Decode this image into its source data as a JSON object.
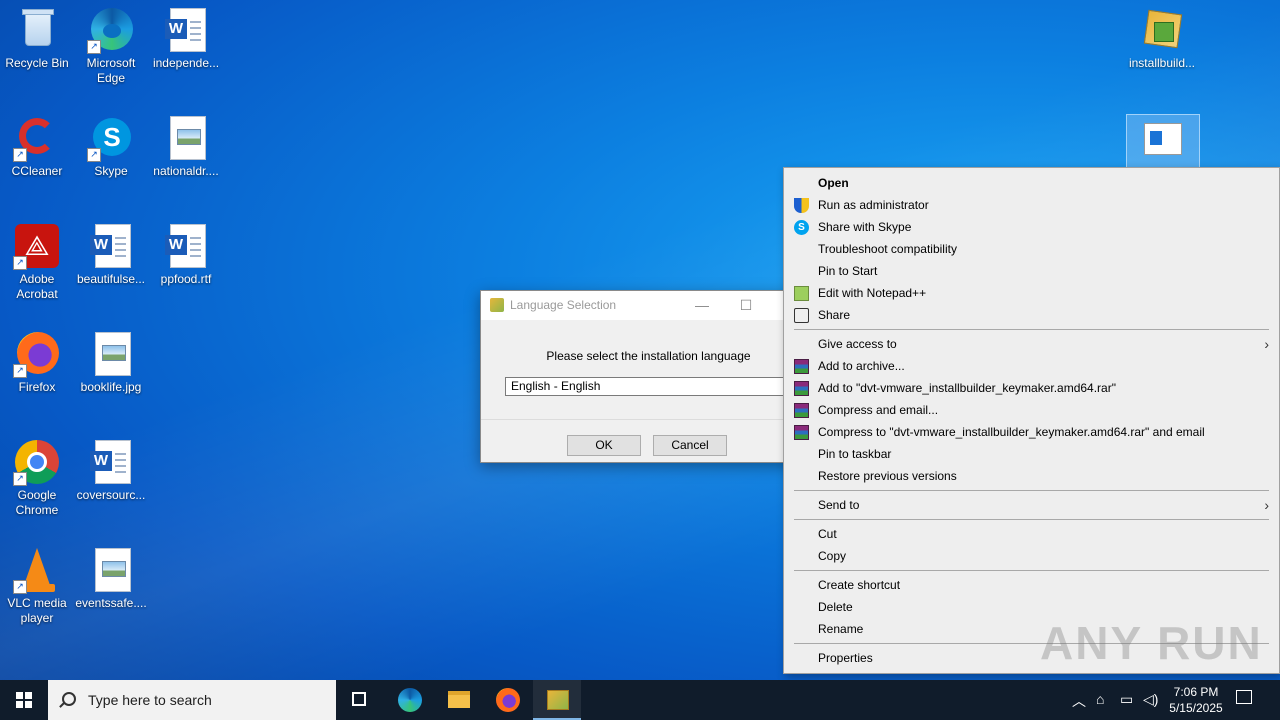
{
  "desktop": {
    "icons": [
      {
        "label": "Recycle Bin"
      },
      {
        "label": "Microsoft Edge"
      },
      {
        "label": "independe..."
      },
      {
        "label": "CCleaner"
      },
      {
        "label": "Skype"
      },
      {
        "label": "nationaldr...."
      },
      {
        "label": "Adobe Acrobat"
      },
      {
        "label": "beautifulse..."
      },
      {
        "label": "ppfood.rtf"
      },
      {
        "label": "Firefox"
      },
      {
        "label": "booklife.jpg"
      },
      {
        "label": "Google Chrome"
      },
      {
        "label": "coversourc..."
      },
      {
        "label": "VLC media player"
      },
      {
        "label": "eventssafe...."
      },
      {
        "label": "installbuild..."
      }
    ]
  },
  "dialog": {
    "title": "Language Selection",
    "prompt": "Please select the installation language",
    "selected_language": "English - English",
    "ok_label": "OK",
    "cancel_label": "Cancel"
  },
  "context_menu": {
    "items": [
      {
        "label": "Open",
        "icon": null,
        "bold": true
      },
      {
        "label": "Run as administrator",
        "icon": "shield-icon"
      },
      {
        "label": "Share with Skype",
        "icon": "skype-icon"
      },
      {
        "label": "Troubleshoot compatibility",
        "icon": null
      },
      {
        "label": "Pin to Start",
        "icon": null
      },
      {
        "label": "Edit with Notepad++",
        "icon": "notepadpp-icon"
      },
      {
        "label": "Share",
        "icon": "share-icon"
      },
      {
        "label": "Give access to",
        "icon": null,
        "submenu": true
      },
      {
        "label": "Add to archive...",
        "icon": "winrar-icon"
      },
      {
        "label": "Add to \"dvt-vmware_installbuilder_keymaker.amd64.rar\"",
        "icon": "winrar-icon"
      },
      {
        "label": "Compress and email...",
        "icon": "winrar-icon"
      },
      {
        "label": "Compress to \"dvt-vmware_installbuilder_keymaker.amd64.rar\" and email",
        "icon": "winrar-icon"
      },
      {
        "label": "Pin to taskbar",
        "icon": null
      },
      {
        "label": "Restore previous versions",
        "icon": null
      },
      {
        "label": "Send to",
        "icon": null,
        "submenu": true
      },
      {
        "label": "Cut",
        "icon": null
      },
      {
        "label": "Copy",
        "icon": null
      },
      {
        "label": "Create shortcut",
        "icon": null
      },
      {
        "label": "Delete",
        "icon": null
      },
      {
        "label": "Rename",
        "icon": null
      },
      {
        "label": "Properties",
        "icon": null
      }
    ]
  },
  "watermark": "ANY RUN",
  "taskbar": {
    "search_placeholder": "Type here to search",
    "time": "7:06 PM",
    "date": "5/15/2025"
  },
  "colors": {
    "taskbar": "#101c2b",
    "menu_bg": "#eeeeee",
    "dialog_bg": "#f0f0f0"
  }
}
